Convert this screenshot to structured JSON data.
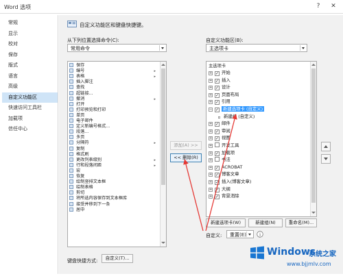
{
  "window": {
    "title": "Word 选项",
    "help_glyph": "?",
    "close_glyph": "✕"
  },
  "nav": {
    "items": [
      {
        "label": "常规",
        "active": false
      },
      {
        "label": "显示",
        "active": false
      },
      {
        "label": "校对",
        "active": false
      },
      {
        "label": "保存",
        "active": false
      },
      {
        "label": "版式",
        "active": false
      },
      {
        "label": "语言",
        "active": false
      },
      {
        "label": "高级",
        "active": false
      },
      {
        "label": "自定义功能区",
        "active": true
      },
      {
        "label": "快速访问工具栏",
        "active": false
      },
      {
        "label": "加载项",
        "active": false
      },
      {
        "label": "信任中心",
        "active": false
      }
    ]
  },
  "header": {
    "text": "自定义功能区和键盘快捷键。"
  },
  "left": {
    "label": "从下列位置选择命令(C):",
    "combo_value": "常用命令",
    "commands": [
      {
        "label": "保存",
        "submenu": false
      },
      {
        "label": "编号",
        "submenu": true
      },
      {
        "label": "表格",
        "submenu": true
      },
      {
        "label": "插入脚注",
        "submenu": false
      },
      {
        "label": "查找",
        "submenu": false
      },
      {
        "label": "超链接...",
        "submenu": false
      },
      {
        "label": "撤消",
        "submenu": true
      },
      {
        "label": "打开",
        "submenu": false
      },
      {
        "label": "打印预览和打印",
        "submenu": false
      },
      {
        "label": "单页",
        "submenu": false
      },
      {
        "label": "电子邮件",
        "submenu": false
      },
      {
        "label": "定义新编号格式...",
        "submenu": false
      },
      {
        "label": "段落...",
        "submenu": false
      },
      {
        "label": "多页",
        "submenu": false
      },
      {
        "label": "分隔符",
        "submenu": true
      },
      {
        "label": "复制",
        "submenu": false
      },
      {
        "label": "格式刷",
        "submenu": false
      },
      {
        "label": "更改列表级别",
        "submenu": true
      },
      {
        "label": "行和段落间距",
        "submenu": true
      },
      {
        "label": "宏",
        "submenu": false
      },
      {
        "label": "恢复",
        "submenu": false
      },
      {
        "label": "绘制竖排文本框",
        "submenu": false
      },
      {
        "label": "绘制表格",
        "submenu": false
      },
      {
        "label": "剪切",
        "submenu": false
      },
      {
        "label": "将所选内容保存到文本框库",
        "submenu": false
      },
      {
        "label": "接受并移到下一条",
        "submenu": false
      },
      {
        "label": "居中",
        "submenu": false
      }
    ],
    "keyboard_label": "键盘快捷方式:",
    "customize_button": "自定义(T)..."
  },
  "middle": {
    "add_button": "添加(A) >>",
    "remove_button": "<< 删除(R)"
  },
  "right": {
    "label": "自定义功能区(B):",
    "combo_value": "主选项卡",
    "tree_header": "主选项卡",
    "tree": [
      {
        "label": "开始",
        "indent": 0,
        "expander": "+",
        "checked": true,
        "selected": false
      },
      {
        "label": "插入",
        "indent": 0,
        "expander": "+",
        "checked": true,
        "selected": false
      },
      {
        "label": "设计",
        "indent": 0,
        "expander": "+",
        "checked": true,
        "selected": false
      },
      {
        "label": "页面布局",
        "indent": 0,
        "expander": "+",
        "checked": true,
        "selected": false
      },
      {
        "label": "引用",
        "indent": 0,
        "expander": "+",
        "checked": true,
        "selected": false
      },
      {
        "label": "新建选项卡 (自定义)",
        "indent": 0,
        "expander": "−",
        "checked": true,
        "selected": true
      },
      {
        "label": "新建组 (自定义)",
        "indent": 1,
        "expander": "",
        "checked": null,
        "selected": false
      },
      {
        "label": "邮件",
        "indent": 0,
        "expander": "+",
        "checked": true,
        "selected": false
      },
      {
        "label": "审阅",
        "indent": 0,
        "expander": "+",
        "checked": true,
        "selected": false
      },
      {
        "label": "视图",
        "indent": 0,
        "expander": "+",
        "checked": true,
        "selected": false
      },
      {
        "label": "开发工具",
        "indent": 0,
        "expander": "+",
        "checked": false,
        "selected": false
      },
      {
        "label": "加载项",
        "indent": 0,
        "expander": "+",
        "checked": true,
        "selected": false
      },
      {
        "label": "书法",
        "indent": 0,
        "expander": "+",
        "checked": false,
        "selected": false
      },
      {
        "label": "ACROBAT",
        "indent": 0,
        "expander": "+",
        "checked": true,
        "selected": false
      },
      {
        "label": "博客文章",
        "indent": 0,
        "expander": "+",
        "checked": true,
        "selected": false
      },
      {
        "label": "插入(博客文章)",
        "indent": 0,
        "expander": "+",
        "checked": true,
        "selected": false
      },
      {
        "label": "大纲",
        "indent": 0,
        "expander": "+",
        "checked": true,
        "selected": false
      },
      {
        "label": "背景消除",
        "indent": 0,
        "expander": "+",
        "checked": true,
        "selected": false
      }
    ],
    "new_tab_button": "新建选项卡(W)",
    "new_group_button": "新建组(N)",
    "rename_button": "重命名(M)...",
    "custom_label": "自定义:",
    "reset_button": "重置(E)",
    "reset_info_glyph": "i"
  },
  "watermark": {
    "brand": "Windows",
    "suffix": "系统之家",
    "url": "www.bjjmlv.com"
  },
  "colors": {
    "selection": "#3399ff",
    "nav_active": "#cfe4f7",
    "annotation_arrow": "#e53935",
    "watermark": "#1565c0"
  }
}
